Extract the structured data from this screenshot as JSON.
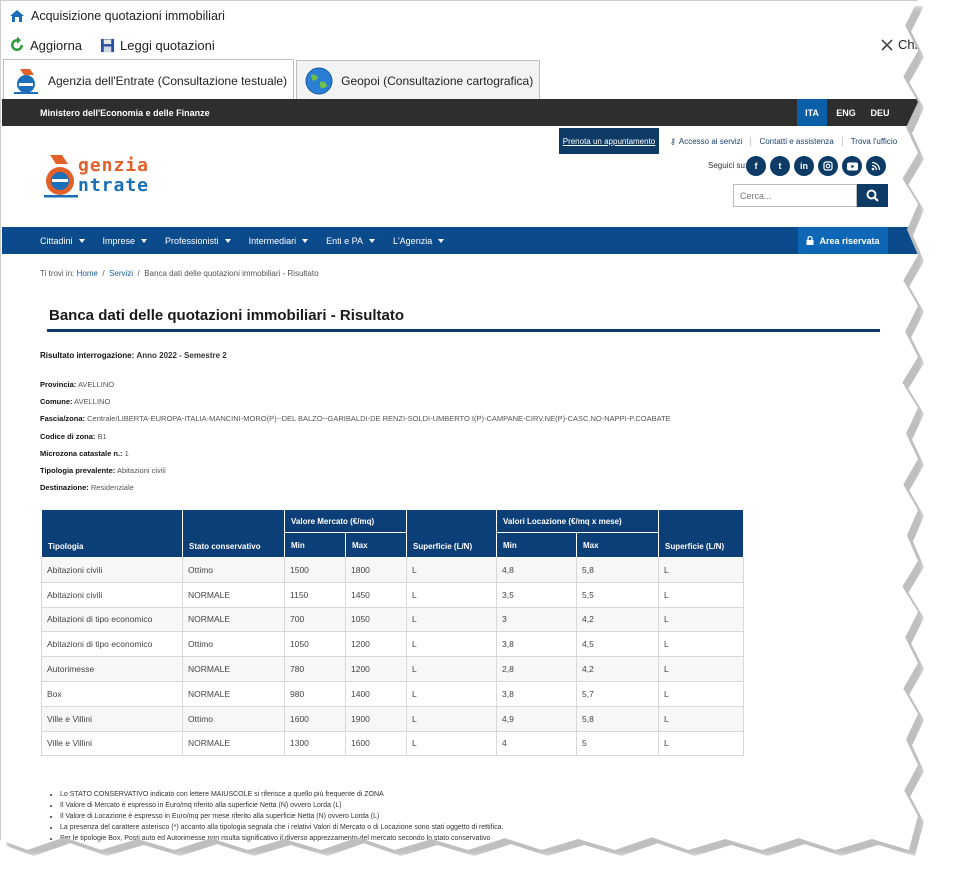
{
  "window": {
    "title": "Acquisizione quotazioni immobiliari",
    "toolbar": {
      "refresh_label": "Aggiorna",
      "read_label": "Leggi quotazioni",
      "close_label": "Chi"
    },
    "tabs": [
      {
        "label": "Agenzia dell'Entrate (Consultazione testuale)"
      },
      {
        "label": "Geopoi (Consultazione cartografica)"
      }
    ]
  },
  "site": {
    "ministry": "Ministero dell'Economia e delle Finanze",
    "languages": [
      "ITA",
      "ENG",
      "DEU"
    ],
    "booking_label": "Prenota un appuntamento",
    "header_links": [
      "Accesso ai servizi",
      "Contatti e assistenza",
      "Trova l'ufficio"
    ],
    "logo": {
      "line1": "genzia",
      "line2": "ntrate"
    },
    "social_label": "Seguici su:",
    "social": [
      "f",
      "t",
      "in",
      "ig",
      "yt",
      "rss"
    ],
    "search_placeholder": "Cerca...",
    "nav": [
      "Cittadini",
      "Imprese",
      "Professionisti",
      "Intermediari",
      "Enti e PA",
      "L'Agenzia"
    ],
    "reserved_area": "Area riservata",
    "breadcrumb": {
      "prefix": "Ti trovi in:",
      "home": "Home",
      "servizi": "Servizi",
      "current": "Banca dati delle quotazioni immobiliari - Risultato"
    },
    "accent": "#0b4a8b"
  },
  "result": {
    "title": "Banca dati delle quotazioni immobiliari - Risultato",
    "query_label": "Risultato interrogazione:",
    "query_value": "Anno 2022 - Semestre 2",
    "fields": [
      {
        "label": "Provincia:",
        "value": "AVELLINO"
      },
      {
        "label": "Comune:",
        "value": "AVELLINO"
      },
      {
        "label": "Fascia/zona:",
        "value": "Centrale/LIBERTA-EUROPA-ITALIA-MANCINI-MORO(P)--DEL BALZO--GARIBALDI-DE RENZI-SOLDI-UMBERTO I(P)-CAMPANE-CIRV.NE(P)-CASC.NO-NAPPI-P.COABATE"
      },
      {
        "label": "Codice di zona:",
        "value": "B1"
      },
      {
        "label": "Microzona catastale n.:",
        "value": "1"
      },
      {
        "label": "Tipologia prevalente:",
        "value": "Abitazioni civili"
      },
      {
        "label": "Destinazione:",
        "value": "Residenziale"
      }
    ],
    "table": {
      "group_market": "Valore Mercato (€/mq)",
      "group_rent": "Valori Locazione (€/mq x mese)",
      "headers": [
        "Tipologia",
        "Stato conservativo",
        "Min",
        "Max",
        "Superficie (L/N)",
        "Min",
        "Max",
        "Superficie (L/N)"
      ],
      "rows": [
        [
          "Abitazioni civili",
          "Ottimo",
          "1500",
          "1800",
          "L",
          "4,8",
          "5,8",
          "L"
        ],
        [
          "Abitazioni civili",
          "NORMALE",
          "1150",
          "1450",
          "L",
          "3,5",
          "5,5",
          "L"
        ],
        [
          "Abitazioni di tipo economico",
          "NORMALE",
          "700",
          "1050",
          "L",
          "3",
          "4,2",
          "L"
        ],
        [
          "Abitazioni di tipo economico",
          "Ottimo",
          "1050",
          "1200",
          "L",
          "3,8",
          "4,5",
          "L"
        ],
        [
          "Autorimesse",
          "NORMALE",
          "780",
          "1200",
          "L",
          "2,8",
          "4,2",
          "L"
        ],
        [
          "Box",
          "NORMALE",
          "980",
          "1400",
          "L",
          "3,8",
          "5,7",
          "L"
        ],
        [
          "Ville e Villini",
          "Ottimo",
          "1600",
          "1900",
          "L",
          "4,9",
          "5,8",
          "L"
        ],
        [
          "Ville e Villini",
          "NORMALE",
          "1300",
          "1600",
          "L",
          "4",
          "5",
          "L"
        ]
      ]
    },
    "notes": [
      "Lo STATO CONSERVATIVO indicato con lettere MAIUSCOLE si riferisce a quello più frequente di ZONA",
      "Il Valore di Mercato è espresso in Euro/mq riferito alla superficie Netta (N) ovvero Lorda (L)",
      "Il Valore di Locazione è espresso in Euro/mq per mese riferito alla superficie Netta (N) ovvero Lorda (L)",
      "La presenza del carattere asterisco (*) accanto alla tipologia segnala che i relativi Valori di Mercato o di Locazione sono stati oggetto di rettifica.",
      "Per le tipologie Box, Posti auto ed Autorimesse non risulta significativo il diverso apprezzamento del mercato secondo lo stato conservativo"
    ]
  }
}
